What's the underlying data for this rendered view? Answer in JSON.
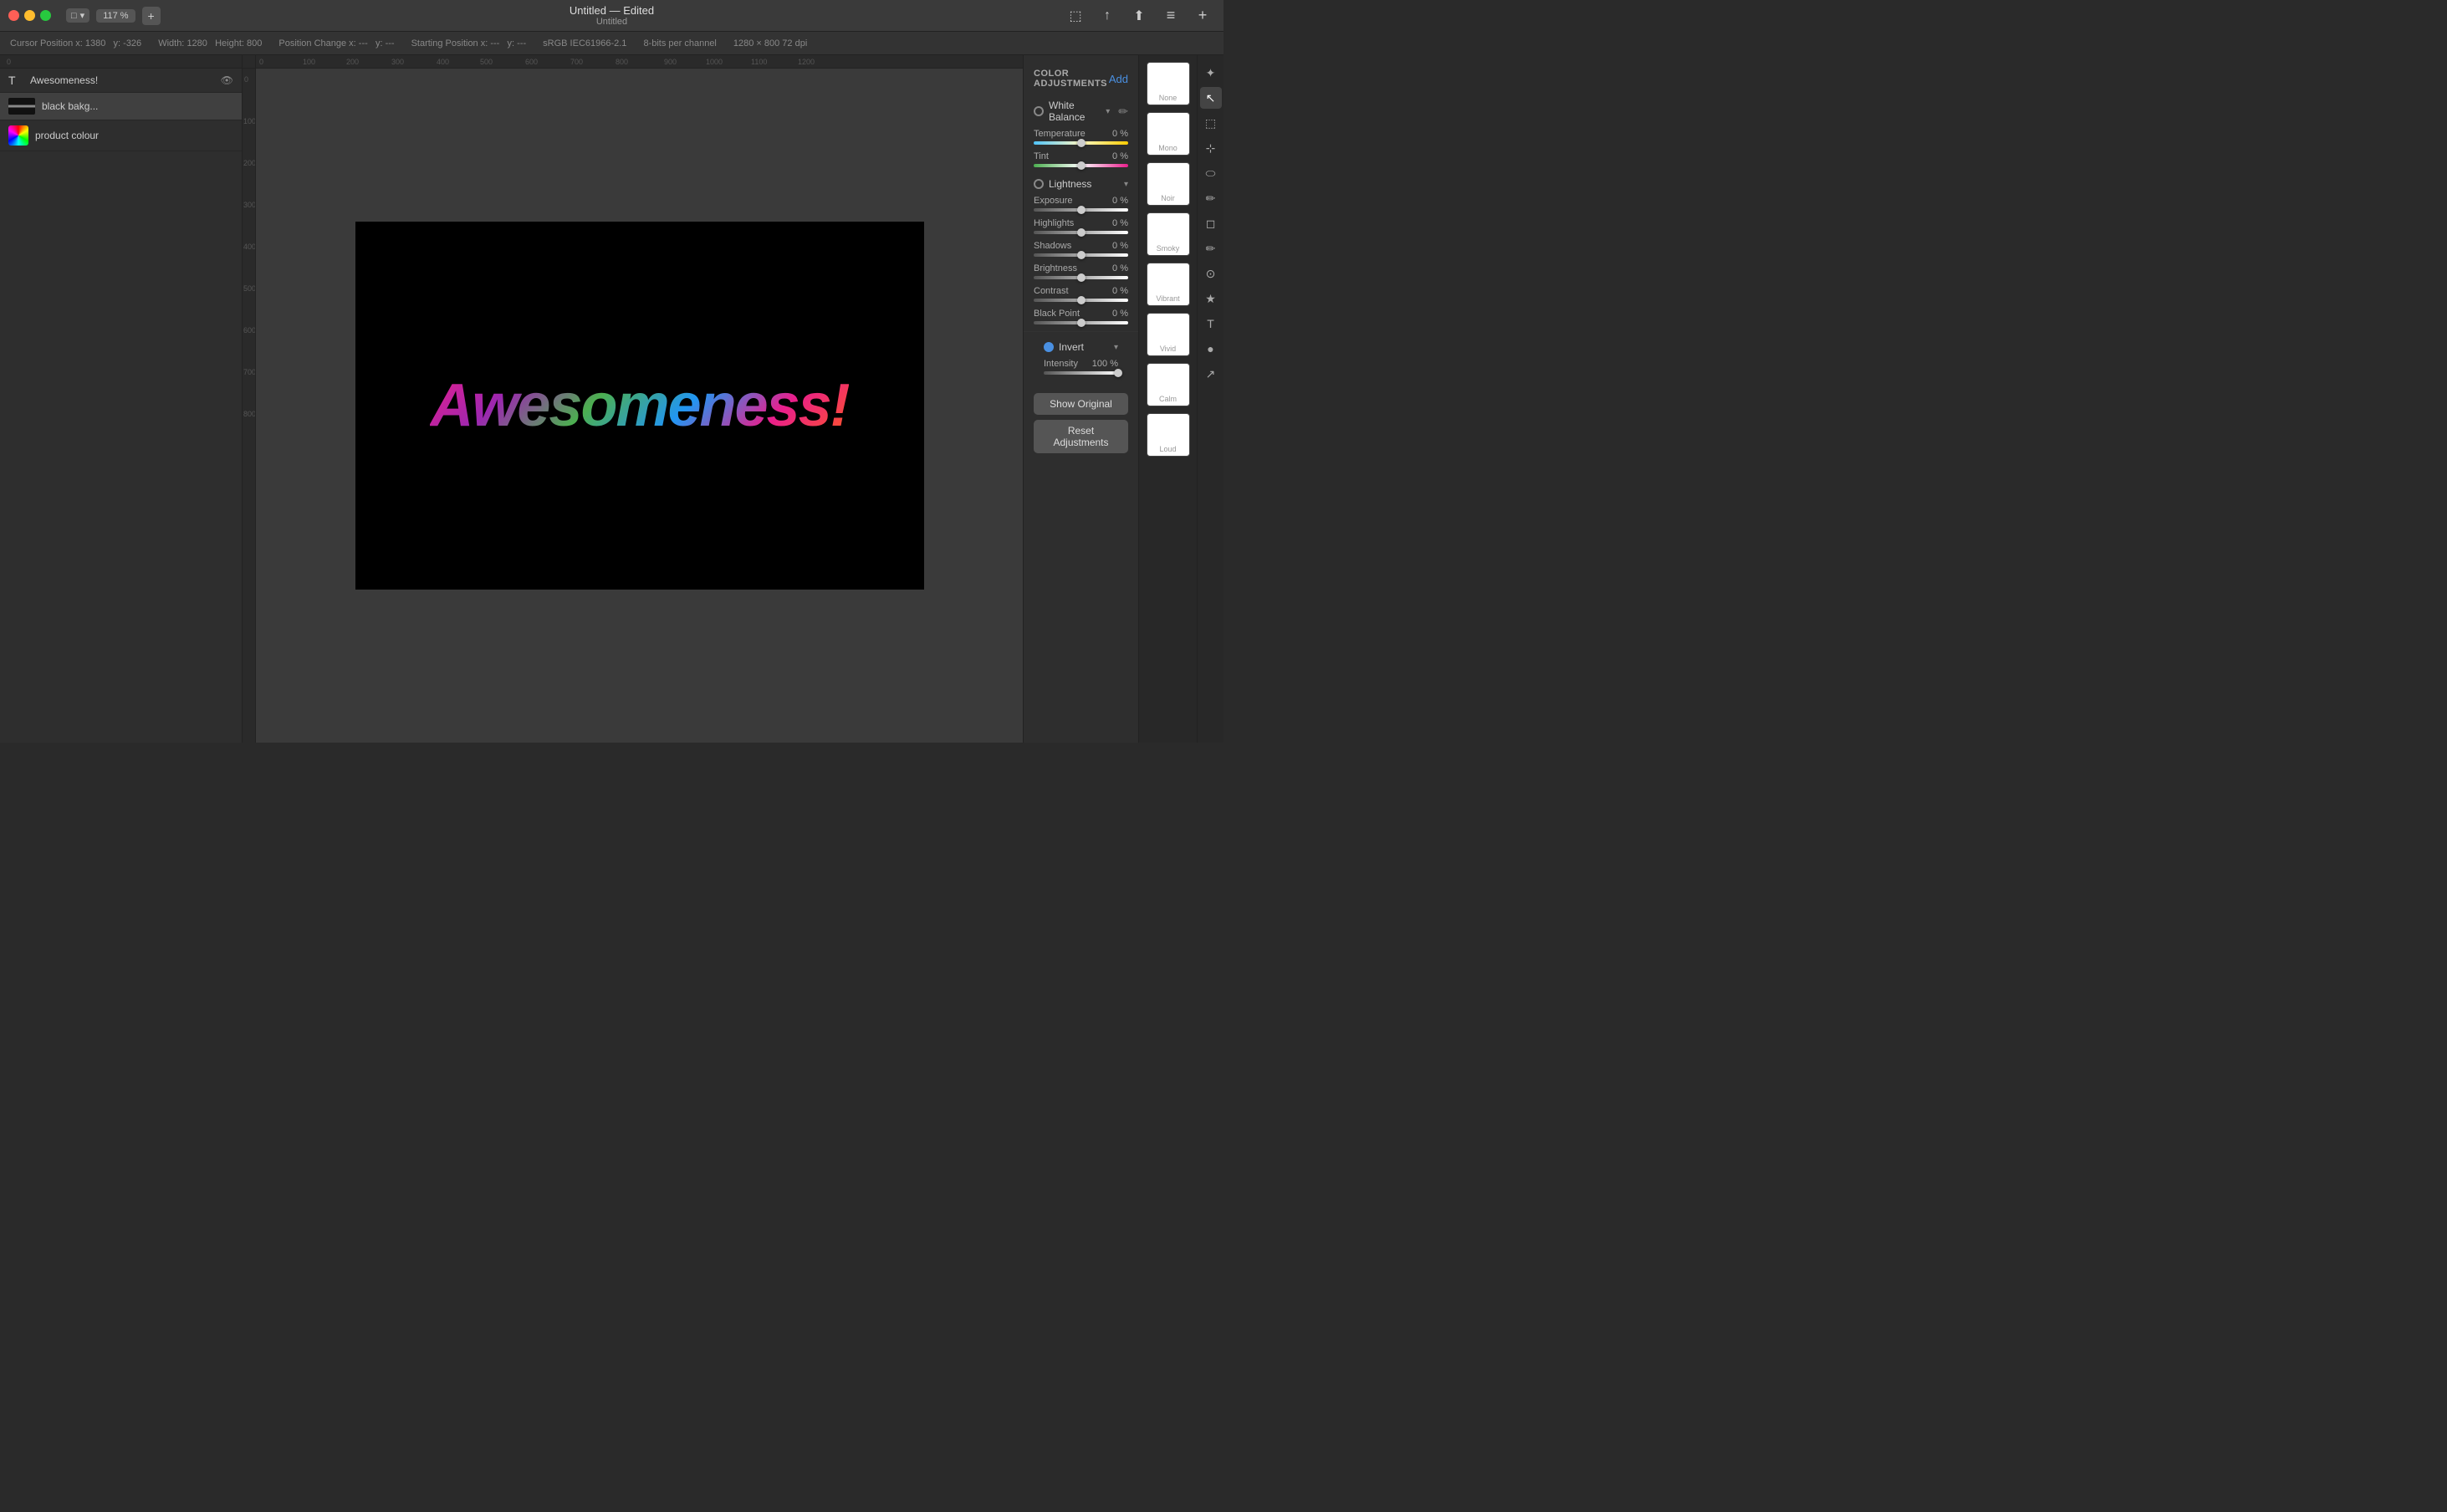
{
  "titlebar": {
    "title": "Untitled — Edited",
    "subtitle": "Untitled",
    "zoom": "117 %",
    "view_label": "□"
  },
  "infobar": {
    "cursor_position_label": "Cursor Position x:",
    "cursor_x": "1380",
    "cursor_y_label": "y:",
    "cursor_y": "-326",
    "width_label": "Width:",
    "width": "1280",
    "height_label": "Height:",
    "height": "800",
    "position_change_label": "Position Change x:",
    "pos_x": "---",
    "pos_y_label": "y:",
    "pos_y": "---",
    "start_pos_label": "Starting Position x:",
    "start_x": "---",
    "start_y_label": "y:",
    "start_y": "---",
    "color_profile": "sRGB IEC61966-2.1",
    "bit_depth": "8-bits per channel",
    "resolution": "1280 × 800 72 dpi"
  },
  "layers": [
    {
      "name": "Awesomeness!",
      "type": "text",
      "visible": true
    },
    {
      "name": "black bakg...",
      "type": "fill",
      "visible": true
    },
    {
      "name": "product colour",
      "type": "image",
      "visible": true
    }
  ],
  "color_adjustments": {
    "title": "COLOR ADJUSTMENTS",
    "add_label": "Add",
    "sections": [
      {
        "name": "White Balance",
        "active": false,
        "sliders": [
          {
            "label": "Temperature",
            "value": "0 %",
            "pct": 50,
            "type": "temp"
          },
          {
            "label": "Tint",
            "value": "0 %",
            "pct": 50,
            "type": "tint"
          }
        ]
      },
      {
        "name": "Lightness",
        "active": false,
        "sliders": [
          {
            "label": "Exposure",
            "value": "0 %",
            "pct": 50,
            "type": "neutral"
          },
          {
            "label": "Highlights",
            "value": "0 %",
            "pct": 50,
            "type": "neutral"
          },
          {
            "label": "Shadows",
            "value": "0 %",
            "pct": 50,
            "type": "neutral"
          },
          {
            "label": "Brightness",
            "value": "0 %",
            "pct": 50,
            "type": "neutral"
          },
          {
            "label": "Contrast",
            "value": "0 %",
            "pct": 50,
            "type": "neutral"
          },
          {
            "label": "Black Point",
            "value": "0 %",
            "pct": 50,
            "type": "neutral"
          }
        ]
      },
      {
        "name": "Invert",
        "active": true,
        "sliders": [
          {
            "label": "Intensity",
            "value": "100 %",
            "pct": 100,
            "type": "neutral"
          }
        ]
      }
    ]
  },
  "layer_thumbnails": [
    {
      "label": "None",
      "bg": "#fff"
    },
    {
      "label": "Mono",
      "bg": "#fff"
    },
    {
      "label": "Noir",
      "bg": "#fff"
    },
    {
      "label": "Smoky",
      "bg": "#fff"
    },
    {
      "label": "Vibrant",
      "bg": "#fff"
    },
    {
      "label": "Vivid",
      "bg": "#fff"
    },
    {
      "label": "Calm",
      "bg": "#fff"
    },
    {
      "label": "Loud",
      "bg": "#fff"
    }
  ],
  "buttons": {
    "show_original": "Show Original",
    "reset_adjustments": "Reset Adjustments"
  },
  "canvas": {
    "text": "Awesomeness!"
  },
  "tools": [
    "✦",
    "↖",
    "⬚",
    "⊹",
    "⬭",
    "✏",
    "⬡",
    "✏",
    "⊙",
    "★",
    "T",
    "●",
    "↗"
  ]
}
